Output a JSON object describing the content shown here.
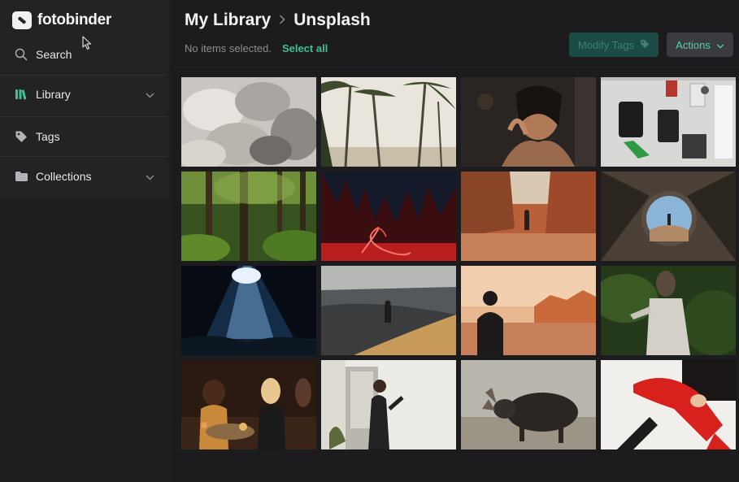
{
  "app": {
    "name": "fotobinder"
  },
  "sidebar": {
    "search_label": "Search",
    "items": [
      {
        "label": "Library",
        "icon": "library-icon",
        "expandable": true
      },
      {
        "label": "Tags",
        "icon": "tag-icon",
        "expandable": false
      },
      {
        "label": "Collections",
        "icon": "folder-icon",
        "expandable": true
      }
    ]
  },
  "header": {
    "breadcrumb": [
      "My Library",
      "Unsplash"
    ],
    "selection_status": "No items selected.",
    "select_all": "Select all",
    "modify_tags": "Modify Tags",
    "actions": "Actions"
  },
  "colors": {
    "accent": "#3fbf9a",
    "sidebar_bg": "#232326",
    "main_bg": "#1c1c1e"
  },
  "photos": [
    {
      "subject": "abstract white folds"
    },
    {
      "subject": "palm trees on beach"
    },
    {
      "subject": "woman with veil portrait"
    },
    {
      "subject": "pegboard wall with gear"
    },
    {
      "subject": "dense green forest"
    },
    {
      "subject": "red light painting at night"
    },
    {
      "subject": "hiker in red canyon"
    },
    {
      "subject": "tent opening with view"
    },
    {
      "subject": "light beams in cave"
    },
    {
      "subject": "person on sand dune"
    },
    {
      "subject": "man in desert at sunset"
    },
    {
      "subject": "woman in white jacket in greenery"
    },
    {
      "subject": "friends dining at table"
    },
    {
      "subject": "man in black coat by door"
    },
    {
      "subject": "moose in grassland"
    },
    {
      "subject": "woman in red tights on chair"
    }
  ]
}
